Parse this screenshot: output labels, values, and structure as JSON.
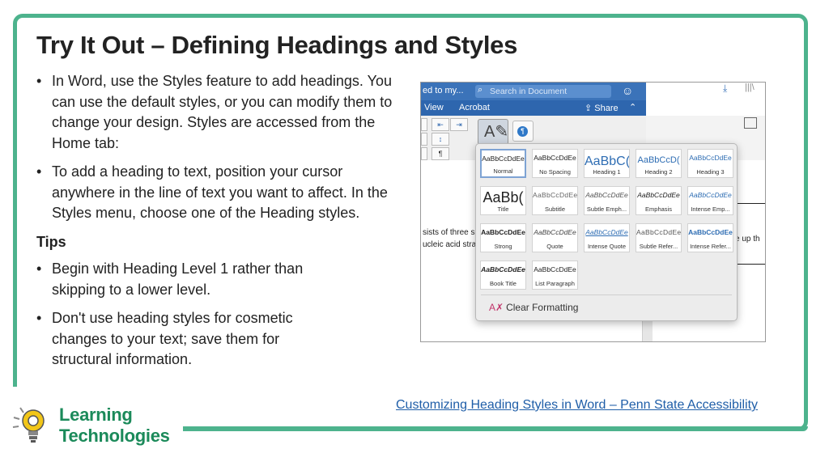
{
  "slide": {
    "title": "Try It Out – Defining Headings and Styles",
    "bullets1": [
      "In Word, use the Styles feature to add headings. You can use the default styles, or you can modify them to change your design. Styles are accessed from the Home tab:",
      "To add a heading to text, position your cursor anywhere in the line of text you want to affect. In the Styles menu, choose one of the Heading styles."
    ],
    "tips_heading": "Tips",
    "tips": [
      "Begin with Heading Level 1 rather than skipping to a lower level.",
      "Don't use heading styles for cosmetic changes to your text; save them for structural information."
    ],
    "link": "Customizing Heading Styles in Word – Penn State Accessibility",
    "logo": {
      "line1": "Learning",
      "line2": "Technologies",
      "icon": "lightbulb-gear-icon"
    },
    "colors": {
      "frame": "#4db38d",
      "link": "#1f5ea8",
      "logo": "#1b8a5a"
    }
  },
  "word": {
    "title_fragment": "ed to my...",
    "search_placeholder": "Search in Document",
    "tabs": {
      "view": "View",
      "acrobat": "Acrobat"
    },
    "share_label": "Share",
    "doc_text": {
      "line1": "sists of three su",
      "line2": "ucleic acid stra",
      "line3": "e up th"
    },
    "styles": [
      {
        "sample": "AaBbCcDdEe",
        "name": "Normal"
      },
      {
        "sample": "AaBbCcDdEe",
        "name": "No Spacing"
      },
      {
        "sample": "AaBbC(",
        "name": "Heading 1"
      },
      {
        "sample": "AaBbCcD(",
        "name": "Heading 2"
      },
      {
        "sample": "AaBbCcDdEe",
        "name": "Heading 3"
      },
      {
        "sample": "AaBb(",
        "name": "Title"
      },
      {
        "sample": "AaBbCcDdEe",
        "name": "Subtitle"
      },
      {
        "sample": "AaBbCcDdEe",
        "name": "Subtle Emph..."
      },
      {
        "sample": "AaBbCcDdEe",
        "name": "Emphasis"
      },
      {
        "sample": "AaBbCcDdEe",
        "name": "Intense Emp..."
      },
      {
        "sample": "AaBbCcDdEe",
        "name": "Strong"
      },
      {
        "sample": "AaBbCcDdEe",
        "name": "Quote"
      },
      {
        "sample": "AaBbCcDdEe",
        "name": "Intense Quote"
      },
      {
        "sample": "AaBbCcDdEe",
        "name": "Subtle Refer..."
      },
      {
        "sample": "AaBbCcDdEe",
        "name": "Intense Refer..."
      },
      {
        "sample": "AaBbCcDdEe",
        "name": "Book Title"
      },
      {
        "sample": "AaBbCcDdEe",
        "name": "List Paragraph"
      }
    ],
    "clear_formatting": "Clear Formatting"
  }
}
